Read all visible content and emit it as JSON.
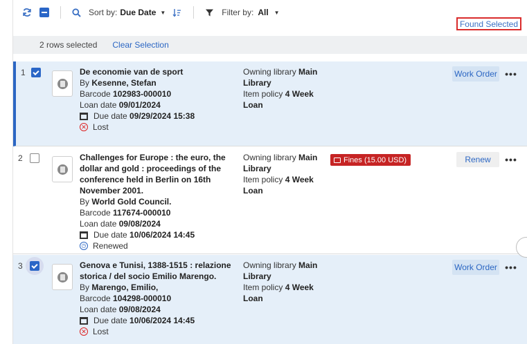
{
  "toolbar": {
    "refresh_icon": "refresh-icon",
    "sort_label": "Sort by:",
    "sort_value": "Due Date",
    "filter_label": "Filter by:",
    "filter_value": "All",
    "found_selected": "Found Selected"
  },
  "selection": {
    "count_text": "2 rows selected",
    "clear_label": "Clear Selection"
  },
  "rows": [
    {
      "num": "1",
      "checked": true,
      "title": "De economie van de sport",
      "by_label": "By",
      "by_value": "Kesenne, Stefan",
      "barcode_label": "Barcode",
      "barcode": "102983-000010",
      "loan_label": "Loan date",
      "loan_date": "09/01/2024",
      "due_label": "Due date",
      "due_date": "09/29/2024 15:38",
      "status": "Lost",
      "owning_label": "Owning library",
      "owning_value": "Main Library",
      "policy_label": "Item policy",
      "policy_value": "4 Week Loan",
      "action": "Work Order"
    },
    {
      "num": "2",
      "checked": false,
      "title": "Challenges for Europe : the euro, the dollar and gold : proceedings of the conference held in Berlin on 16th November 2001.",
      "by_label": "By",
      "by_value": "World Gold Council.",
      "barcode_label": "Barcode",
      "barcode": "117674-000010",
      "loan_label": "Loan date",
      "loan_date": "09/08/2024",
      "due_label": "Due date",
      "due_date": "10/06/2024 14:45",
      "status": "Renewed",
      "owning_label": "Owning library",
      "owning_value": "Main Library",
      "policy_label": "Item policy",
      "policy_value": "4 Week Loan",
      "fines": "Fines (15.00 USD)",
      "action": "Renew"
    },
    {
      "num": "3",
      "checked": true,
      "title": "Genova e Tunisi, 1388-1515 : relazione storica / del socio Emilio Marengo.",
      "by_label": "By",
      "by_value": "Marengo, Emilio,",
      "barcode_label": "Barcode",
      "barcode": "104298-000010",
      "loan_label": "Loan date",
      "loan_date": "09/08/2024",
      "due_label": "Due date",
      "due_date": "10/06/2024 14:45",
      "status": "Lost",
      "owning_label": "Owning library",
      "owning_value": "Main Library",
      "policy_label": "Item policy",
      "policy_value": "4 Week Loan",
      "action": "Work Order"
    }
  ],
  "more_label": "•••",
  "colors": {
    "accent": "#2a66c7",
    "selected_row": "#e5eff9",
    "fines": "#c62424",
    "found_border": "#d92b2b"
  }
}
